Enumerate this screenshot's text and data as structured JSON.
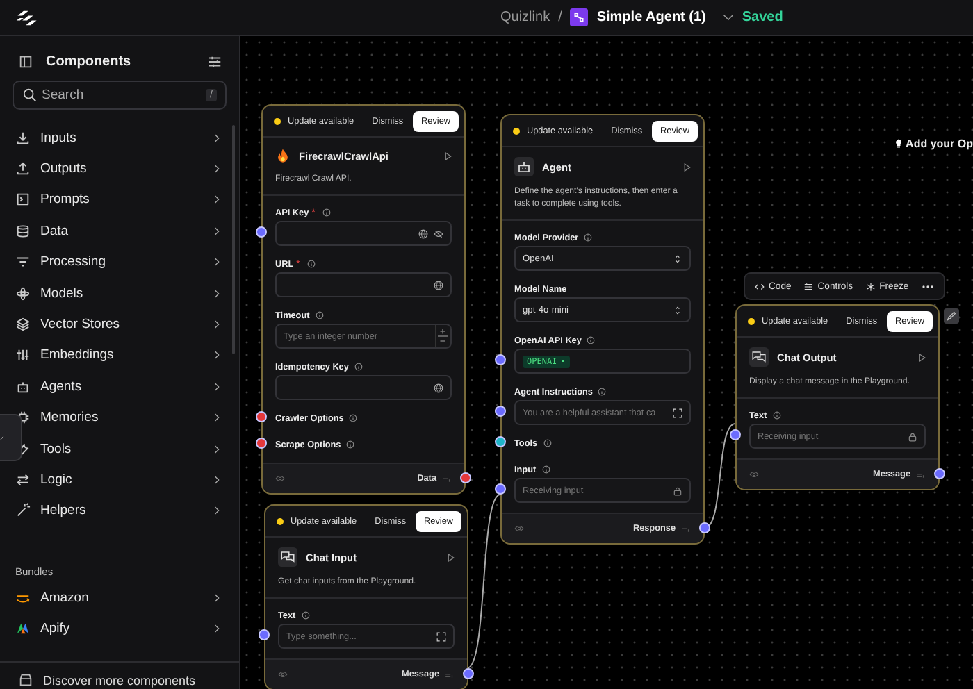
{
  "topbar": {
    "workspace": "Quizlink",
    "separator": "/",
    "flow": "Simple Agent (1)",
    "status": "Saved"
  },
  "sidebar": {
    "title": "Components",
    "search": {
      "placeholder": "Search",
      "shortcut": "/"
    },
    "categories": [
      "Inputs",
      "Outputs",
      "Prompts",
      "Data",
      "Processing",
      "Models",
      "Vector Stores",
      "Embeddings",
      "Agents",
      "Memories",
      "Tools",
      "Logic",
      "Helpers"
    ],
    "bundles_heading": "Bundles",
    "bundles": [
      "Amazon",
      "Apify"
    ],
    "footer": "Discover more components"
  },
  "canvas": {
    "hint": "Add your Op",
    "node_toolbar": [
      "Code",
      "Controls",
      "Freeze"
    ],
    "nodes": [
      {
        "kind": "tool",
        "title": "FirecrawlCrawlApi",
        "description": "Firecrawl Crawl API.",
        "update": {
          "text": "Update available",
          "dismiss": "Dismiss",
          "review": "Review"
        },
        "output": {
          "label": "Data",
          "color": "#e5383b"
        },
        "fields": [
          {
            "label": "API Key",
            "required_mark": "*",
            "info": true,
            "kind": "secret",
            "color": "#6b6bff"
          },
          {
            "label": "URL",
            "required_mark": "*",
            "info": true,
            "kind": "global"
          },
          {
            "label": "Timeout",
            "info": true,
            "kind": "number",
            "placeholder": "Type an integer number"
          },
          {
            "label": "Idempotency Key",
            "info": true,
            "kind": "global"
          },
          {
            "label": "Crawler Options",
            "info": true,
            "kind": "handle",
            "color": "#e5383b"
          },
          {
            "label": "Scrape Options",
            "info": true,
            "kind": "handle",
            "color": "#e5383b"
          }
        ]
      },
      {
        "kind": "agent",
        "title": "Agent",
        "description": "Define the agent's instructions, then enter a task to complete using tools.",
        "update": {
          "text": "Update available",
          "dismiss": "Dismiss",
          "review": "Review"
        },
        "output": {
          "label": "Response",
          "color": "#6b6bff"
        },
        "fields": [
          {
            "label": "Model Provider",
            "info": true,
            "kind": "select",
            "value": "OpenAI"
          },
          {
            "label": "Model Name",
            "info": false,
            "kind": "select",
            "value": "gpt-4o-mini"
          },
          {
            "label": "OpenAI API Key",
            "info": true,
            "kind": "tag",
            "value": "OPENAI",
            "color": "#6b6bff"
          },
          {
            "label": "Agent Instructions",
            "info": true,
            "kind": "prompt",
            "placeholder": "You are a helpful assistant that ca",
            "color": "#6b6bff"
          },
          {
            "label": "Tools",
            "info": true,
            "kind": "handle",
            "color": "#1fb5c8"
          },
          {
            "label": "Input",
            "info": true,
            "kind": "locked",
            "placeholder": "Receiving input",
            "color": "#6b6bff"
          }
        ]
      },
      {
        "kind": "input",
        "title": "Chat Input",
        "description": "Get chat inputs from the Playground.",
        "update": {
          "text": "Update available",
          "dismiss": "Dismiss",
          "review": "Review"
        },
        "output": {
          "label": "Message",
          "color": "#6b6bff"
        },
        "fields": [
          {
            "label": "Text",
            "info": true,
            "kind": "prompt",
            "placeholder": "Type something...",
            "color": "#6b6bff"
          }
        ]
      },
      {
        "kind": "output",
        "title": "Chat Output",
        "description": "Display a chat message in the Playground.",
        "update": {
          "text": "Update available",
          "dismiss": "Dismiss",
          "review": "Review"
        },
        "output": {
          "label": "Message",
          "color": "#6b6bff"
        },
        "fields": [
          {
            "label": "Text",
            "info": true,
            "kind": "locked",
            "placeholder": "Receiving input",
            "color": "#6b6bff"
          }
        ]
      }
    ]
  }
}
